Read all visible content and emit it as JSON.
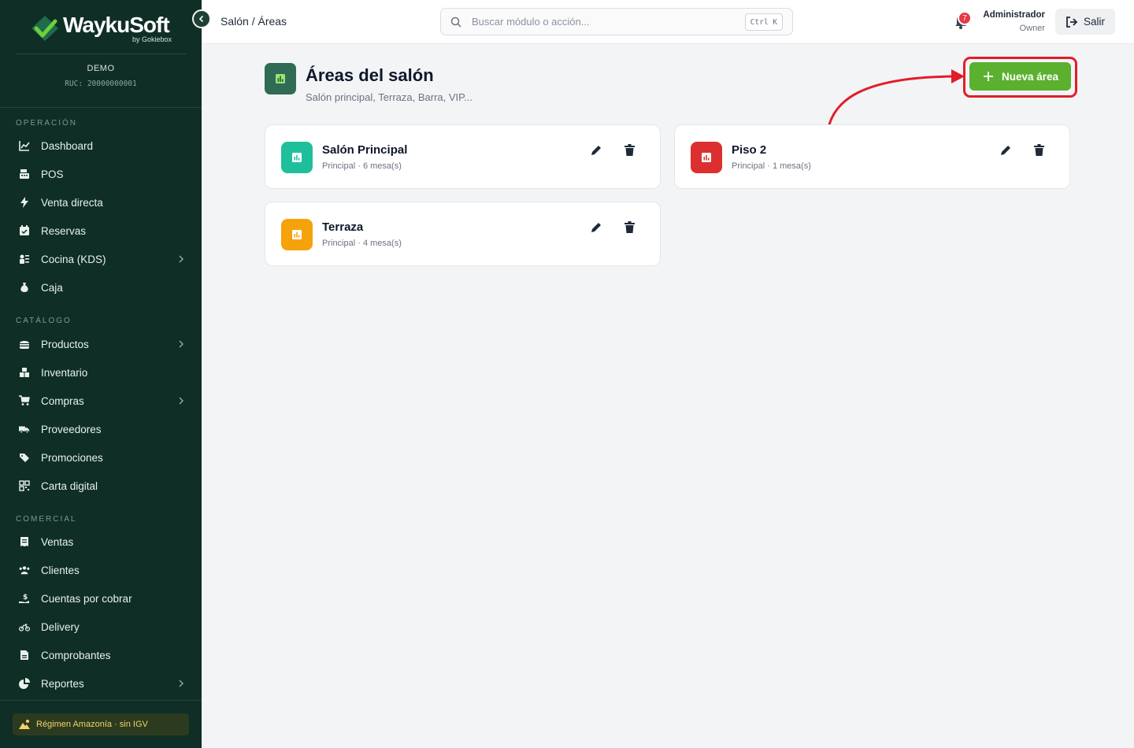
{
  "brand": {
    "name": "WaykuSoft",
    "by": "by Gokiebox"
  },
  "company": {
    "name": "DEMO",
    "ruc": "RUC: 20000000001"
  },
  "sidebar": {
    "sections": [
      {
        "title": "OPERACIÓN",
        "items": [
          {
            "label": "Dashboard",
            "icon": "chart-line-icon"
          },
          {
            "label": "POS",
            "icon": "cash-register-icon"
          },
          {
            "label": "Venta directa",
            "icon": "bolt-icon"
          },
          {
            "label": "Reservas",
            "icon": "calendar-check-icon"
          },
          {
            "label": "Cocina (KDS)",
            "icon": "kitchen-icon",
            "chevron": true
          },
          {
            "label": "Caja",
            "icon": "money-bag-icon"
          }
        ]
      },
      {
        "title": "CATÁLOGO",
        "items": [
          {
            "label": "Productos",
            "icon": "burger-icon",
            "chevron": true
          },
          {
            "label": "Inventario",
            "icon": "boxes-icon"
          },
          {
            "label": "Compras",
            "icon": "cart-icon",
            "chevron": true
          },
          {
            "label": "Proveedores",
            "icon": "truck-icon"
          },
          {
            "label": "Promociones",
            "icon": "tags-icon"
          },
          {
            "label": "Carta digital",
            "icon": "qr-code-icon"
          }
        ]
      },
      {
        "title": "COMERCIAL",
        "items": [
          {
            "label": "Ventas",
            "icon": "receipt-icon"
          },
          {
            "label": "Clientes",
            "icon": "users-icon"
          },
          {
            "label": "Cuentas por cobrar",
            "icon": "hand-dollar-icon"
          },
          {
            "label": "Delivery",
            "icon": "motorcycle-icon"
          },
          {
            "label": "Comprobantes",
            "icon": "file-invoice-icon"
          },
          {
            "label": "Reportes",
            "icon": "pie-chart-icon",
            "chevron": true
          }
        ]
      }
    ],
    "footer_badge": "Régimen Amazonía · sin IGV"
  },
  "header": {
    "breadcrumb": "Salón / Áreas",
    "search_placeholder": "Buscar módulo o acción...",
    "shortcut": "Ctrl K",
    "notifications": "7",
    "user_name": "Administrador",
    "user_role": "Owner",
    "logout_label": "Salir"
  },
  "main": {
    "title": "Áreas del salón",
    "subtitle": "Salón principal, Terraza, Barra, VIP...",
    "new_button": "Nueva área",
    "areas": [
      {
        "name": "Salón Principal",
        "meta": "Principal · 6 mesa(s)",
        "color": "#1fbf9c"
      },
      {
        "name": "Piso 2",
        "meta": "Principal · 1 mesa(s)",
        "color": "#dc3030"
      },
      {
        "name": "Terraza",
        "meta": "Principal · 4 mesa(s)",
        "color": "#f5a20b"
      }
    ]
  },
  "colors": {
    "sidebar_bg": "#0f2e26",
    "accent_green": "#5bb02f",
    "highlight_red": "#e11d2a"
  }
}
